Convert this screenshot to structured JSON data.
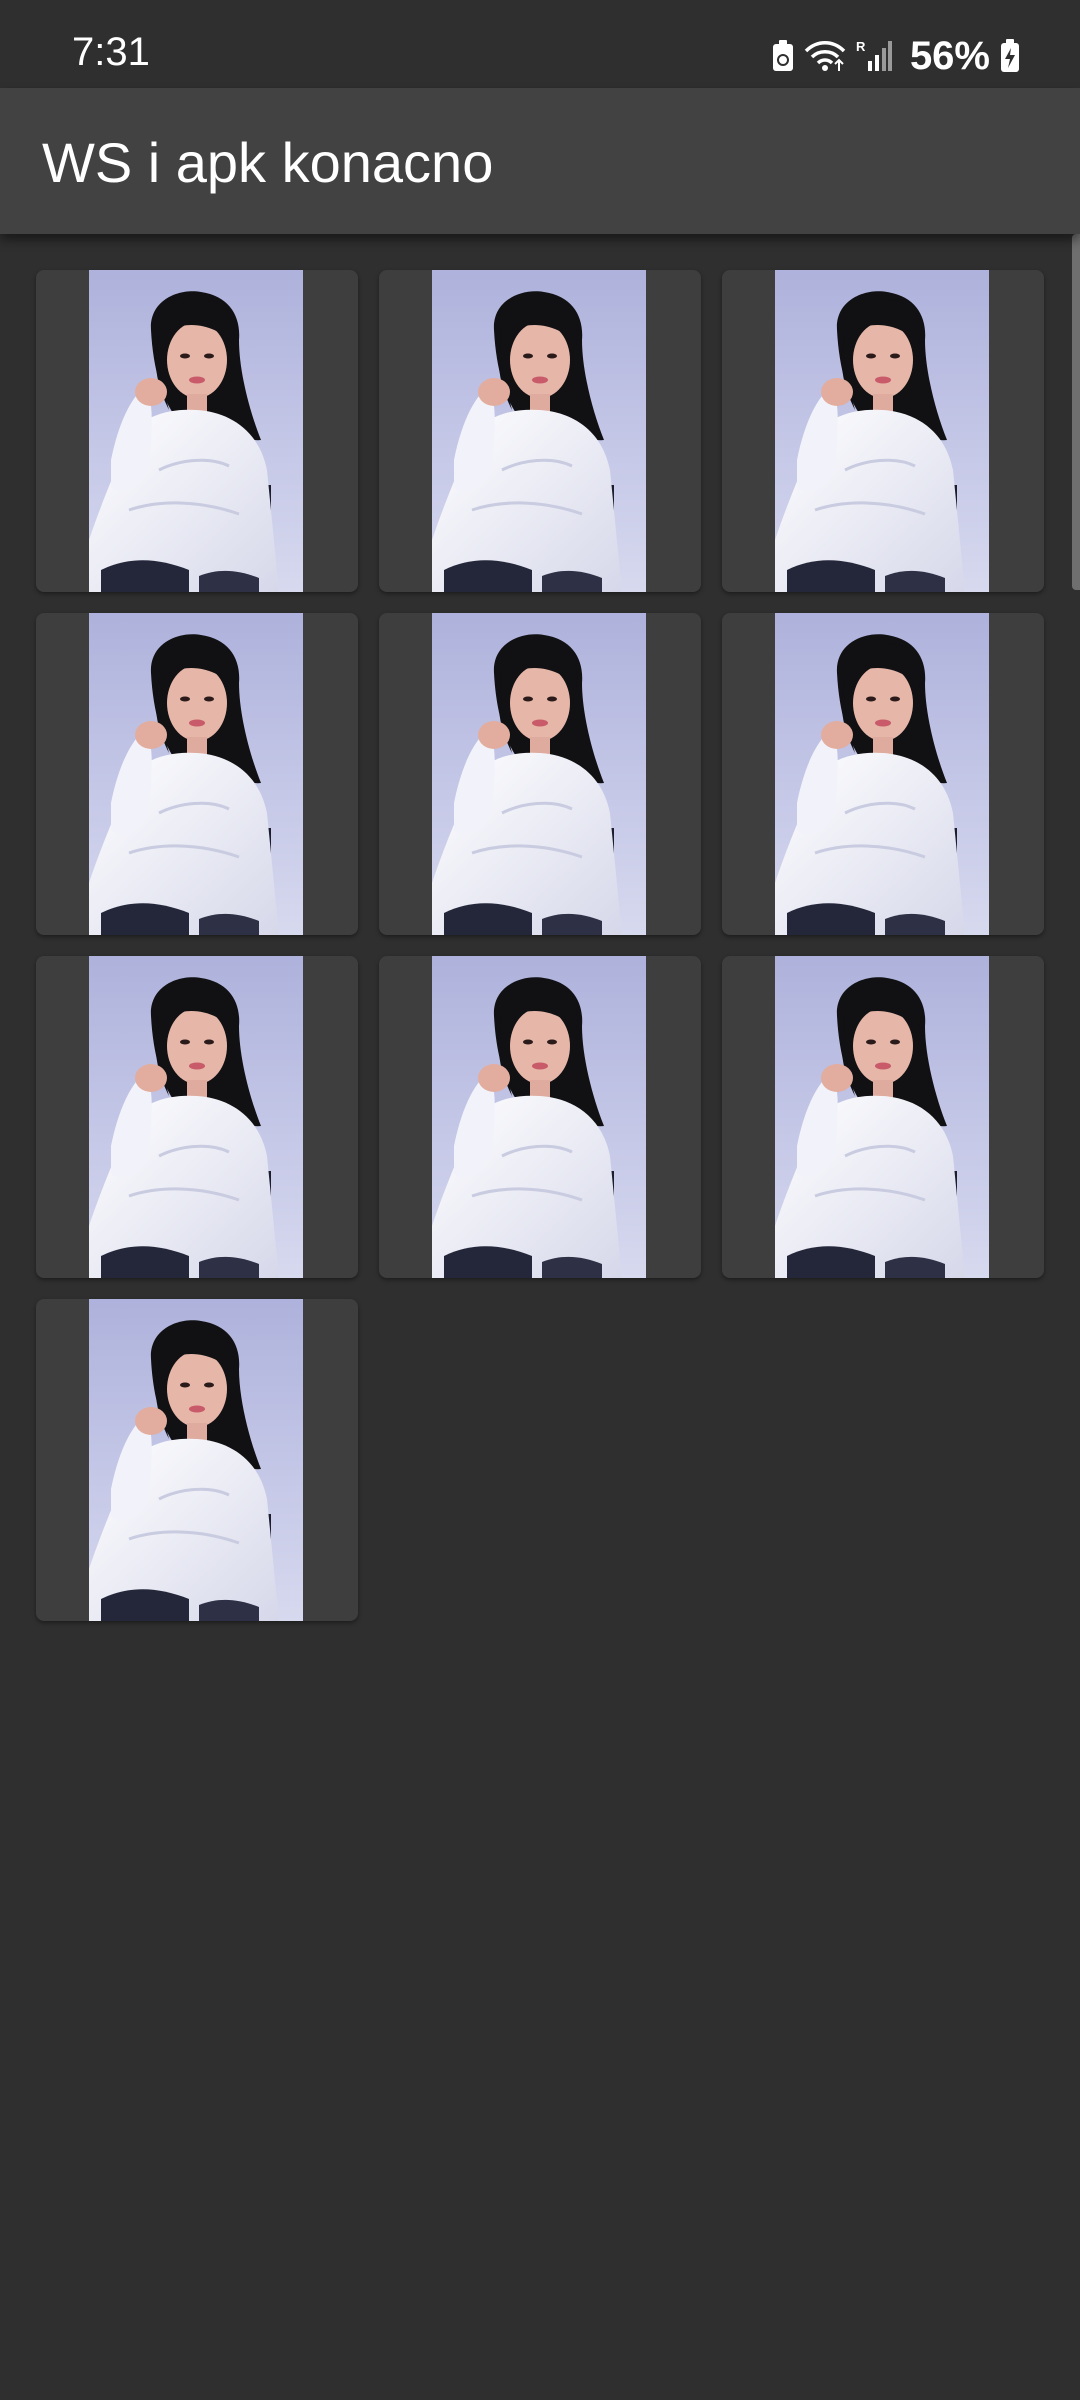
{
  "status_bar": {
    "time": "7:31",
    "battery_percent": "56%",
    "icons": [
      "battery-saver-icon",
      "wifi-icon",
      "signal-roaming-icon",
      "battery-charging-icon"
    ]
  },
  "app_bar": {
    "title": "WS i apk konacno"
  },
  "gallery": {
    "items": [
      {
        "image": "portrait-photo"
      },
      {
        "image": "portrait-photo"
      },
      {
        "image": "portrait-photo"
      },
      {
        "image": "portrait-photo"
      },
      {
        "image": "portrait-photo"
      },
      {
        "image": "portrait-photo"
      },
      {
        "image": "portrait-photo"
      },
      {
        "image": "portrait-photo"
      },
      {
        "image": "portrait-photo"
      },
      {
        "image": "portrait-photo"
      }
    ]
  },
  "colors": {
    "background": "#2f2f2f",
    "app_bar": "#424242",
    "tile": "#3e3e3e",
    "photo_backdrop": "#b8bce0"
  }
}
